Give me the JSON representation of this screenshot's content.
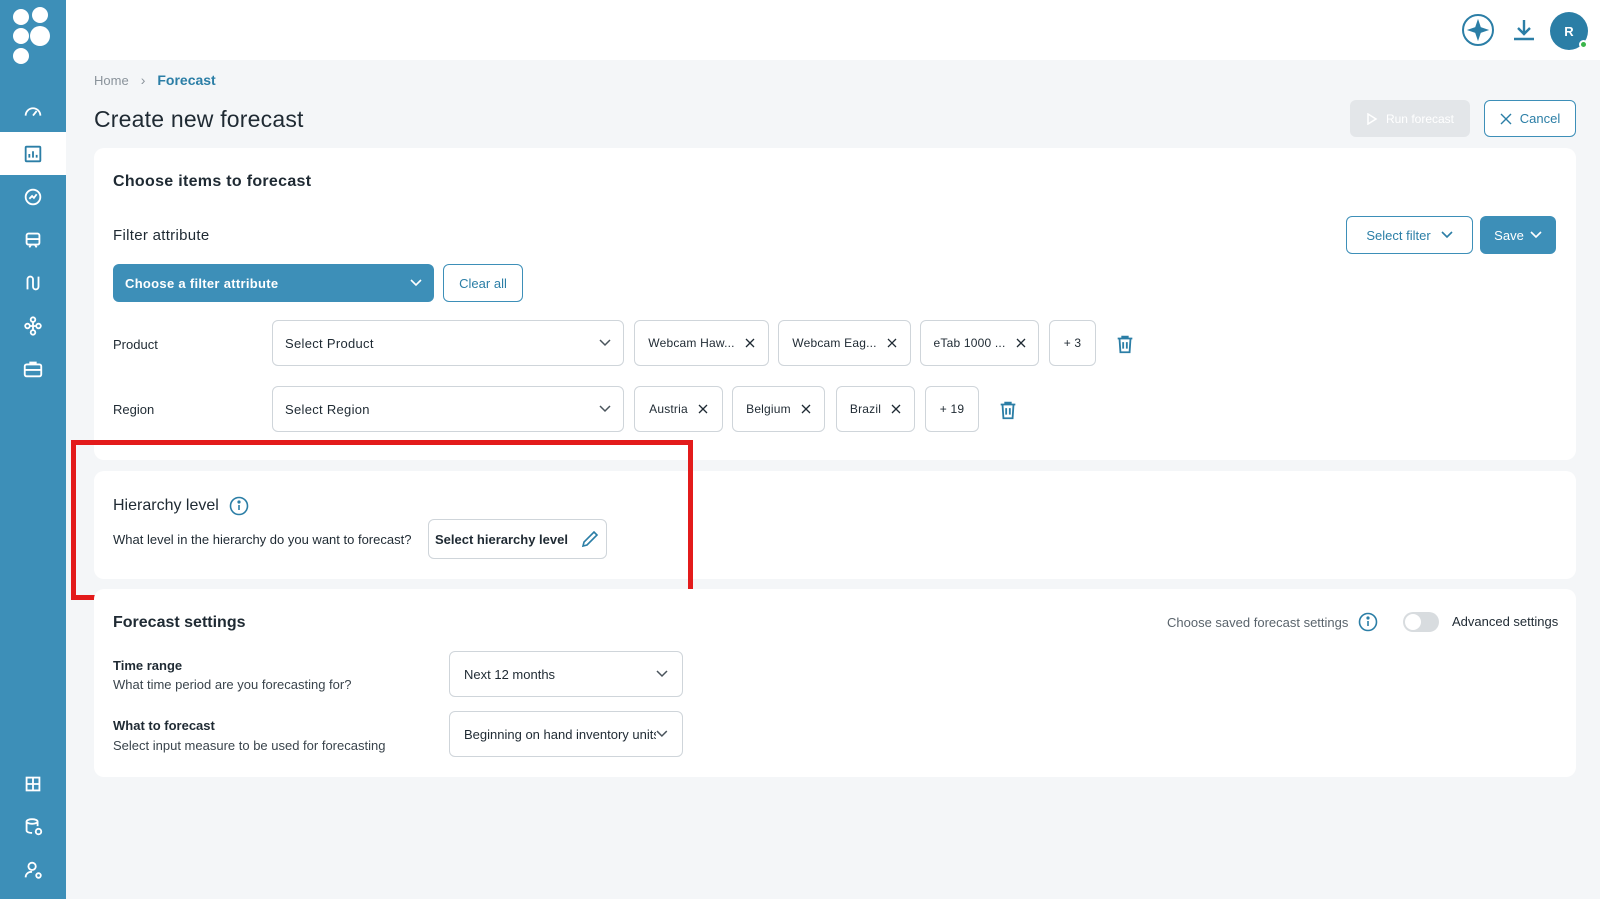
{
  "sidebar": {
    "logo": "app-logo",
    "items": [
      {
        "icon": "dashboard-icon",
        "active": false
      },
      {
        "icon": "forecast-chart-icon",
        "active": true
      },
      {
        "icon": "analytics-icon",
        "active": false
      },
      {
        "icon": "supply-icon",
        "active": false
      },
      {
        "icon": "route-icon",
        "active": false
      },
      {
        "icon": "network-icon",
        "active": false
      },
      {
        "icon": "briefcase-icon",
        "active": false
      }
    ],
    "bottom_items": [
      {
        "icon": "reports-icon"
      },
      {
        "icon": "data-settings-icon"
      },
      {
        "icon": "user-settings-icon"
      }
    ]
  },
  "topbar": {
    "ai_icon": "sparkle-icon",
    "download_icon": "download-icon",
    "avatar_initial": "R",
    "status": "online"
  },
  "breadcrumb": {
    "home": "Home",
    "current": "Forecast"
  },
  "page": {
    "title": "Create new forecast",
    "run_label": "Run forecast",
    "cancel_label": "Cancel"
  },
  "items_section": {
    "title": "Choose items to forecast",
    "filter_attribute_label": "Filter attribute",
    "choose_filter_label": "Choose a filter attribute",
    "clear_all_label": "Clear all",
    "select_filter_label": "Select filter",
    "save_label": "Save",
    "filters": [
      {
        "name": "Product",
        "placeholder": "Select Product",
        "chips": [
          "Webcam Haw...",
          "Webcam Eag...",
          "eTab 1000 ..."
        ],
        "more": "+ 3"
      },
      {
        "name": "Region",
        "placeholder": "Select Region",
        "chips": [
          "Austria",
          "Belgium",
          "Brazil"
        ],
        "more": "+ 19"
      }
    ]
  },
  "hierarchy": {
    "title": "Hierarchy level",
    "question": "What level in the hierarchy do you want to forecast?",
    "button_label": "Select hierarchy level"
  },
  "forecast_settings": {
    "title": "Forecast settings",
    "saved_settings_label": "Choose saved forecast settings",
    "advanced_label": "Advanced settings",
    "advanced_enabled": false,
    "time_range": {
      "title": "Time range",
      "description": "What time period are you forecasting for?",
      "value": "Next 12 months"
    },
    "what_to_forecast": {
      "title": "What to forecast",
      "description": "Select input measure to be used for forecasting",
      "value": "Beginning on hand inventory units"
    }
  },
  "colors": {
    "primary": "#3d8fb8",
    "highlight": "#e31b1b"
  }
}
